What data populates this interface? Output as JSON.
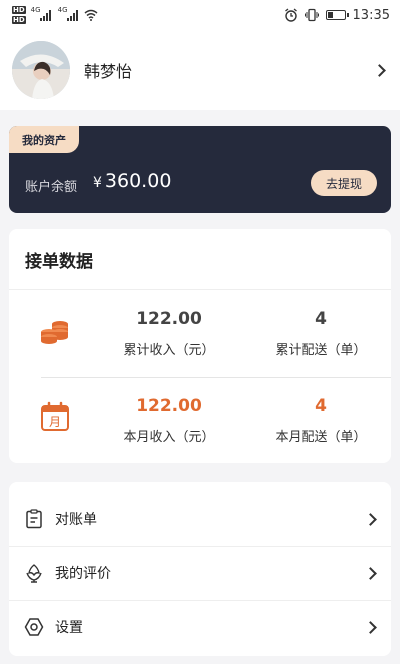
{
  "status_bar": {
    "time": "13:35",
    "network_1": "4G",
    "network_2": "4G",
    "hd_1": "HD",
    "hd_2": "HD"
  },
  "profile": {
    "name": "韩梦怡"
  },
  "assets": {
    "tag": "我的资产",
    "balance_label": "账户余额",
    "currency": "¥",
    "balance": "360.00",
    "withdraw_label": "去提现"
  },
  "orders": {
    "title": "接单数据",
    "total_income_value": "122.00",
    "total_income_label": "累计收入（元）",
    "total_delivery_value": "4",
    "total_delivery_label": "累计配送（单）",
    "month_income_value": "122.00",
    "month_income_label": "本月收入（元）",
    "month_delivery_value": "4",
    "month_delivery_label": "本月配送（单）",
    "calendar_glyph": "月"
  },
  "menu": {
    "items": [
      {
        "label": "对账单",
        "icon": "clipboard-icon"
      },
      {
        "label": "我的评价",
        "icon": "rating-icon"
      },
      {
        "label": "设置",
        "icon": "settings-icon"
      }
    ]
  },
  "colors": {
    "accent": "#e06a30",
    "dark_card": "#252a3c",
    "gold": "#f6dcc4"
  }
}
